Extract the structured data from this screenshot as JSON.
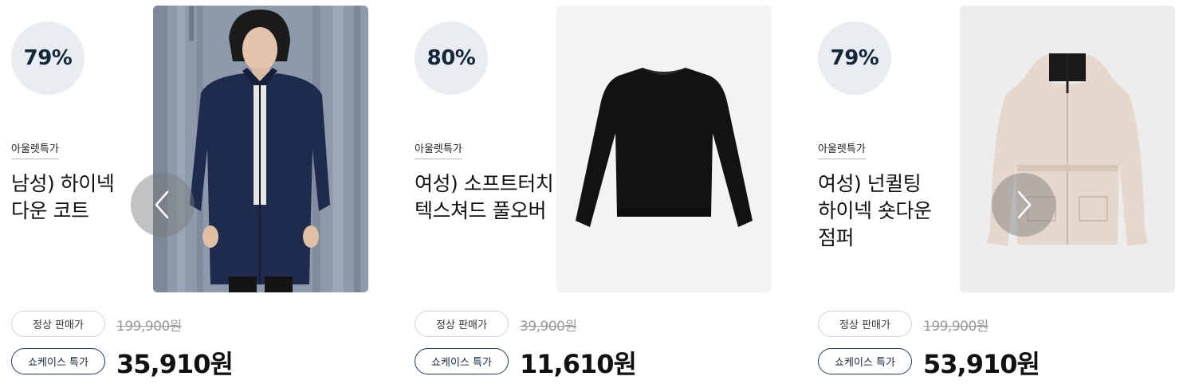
{
  "navigation": {
    "prev_icon": "chevron-left-icon",
    "next_icon": "chevron-right-icon"
  },
  "products": [
    {
      "discount": "79%",
      "tag": "아울렛특가",
      "title": "남성) 하이넥\n다운 코트",
      "image": "navy-down-coat-model",
      "regular_label": "정상 판매가",
      "original_price": "199,900원",
      "special_label": "쇼케이스 특가",
      "special_price": "35,910원"
    },
    {
      "discount": "80%",
      "tag": "아울렛특가",
      "title": "여성) 소프트터치\n텍스쳐드 풀오버",
      "image": "black-pullover",
      "regular_label": "정상 판매가",
      "original_price": "39,900원",
      "special_label": "쇼케이스 특가",
      "special_price": "11,610원"
    },
    {
      "discount": "79%",
      "tag": "아울렛특가",
      "title": "여성) 넌퀼팅\n하이넥 숏다운\n점퍼",
      "image": "beige-short-down-jacket",
      "regular_label": "정상 판매가",
      "original_price": "199,900원",
      "special_label": "쇼케이스 특가",
      "special_price": "53,910원"
    }
  ]
}
